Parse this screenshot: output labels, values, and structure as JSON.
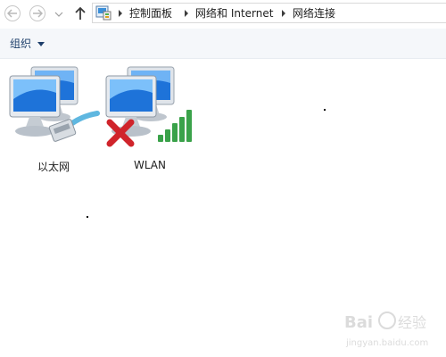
{
  "address_bar": {
    "breadcrumbs": [
      "控制面板",
      "网络和 Internet",
      "网络连接"
    ]
  },
  "command_bar": {
    "organize_label": "组织"
  },
  "connections": [
    {
      "label": "以太网",
      "icon": "ethernet-connection-icon",
      "status": "connected"
    },
    {
      "label": "WLAN",
      "icon": "wlan-connection-icon",
      "status": "disconnected"
    }
  ],
  "watermark": {
    "brand": "Baidu 经验",
    "url": "jingyan.baidu.com"
  },
  "colors": {
    "monitor_blue": "#1e73d9",
    "disconnected_red": "#d0242b",
    "signal_green": "#3aa24a",
    "cable_blue": "#5fb7e0"
  }
}
